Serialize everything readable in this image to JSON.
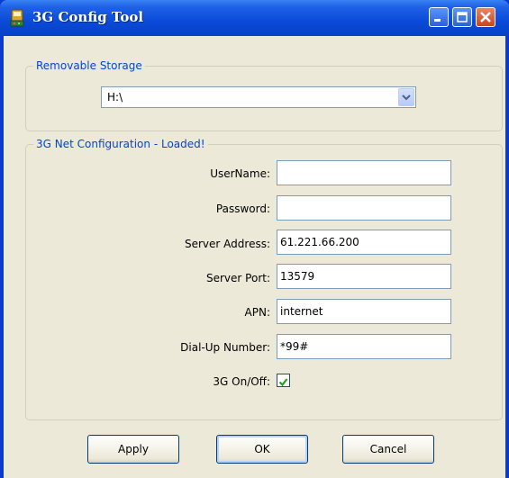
{
  "window": {
    "title": "3G Config Tool"
  },
  "removable_storage": {
    "legend": "Removable Storage",
    "selected_drive": "H:\\"
  },
  "net_config": {
    "legend": "3G Net Configuration - Loaded!",
    "fields": [
      {
        "label": "UserName:",
        "value": ""
      },
      {
        "label": "Password:",
        "value": ""
      },
      {
        "label": "Server Address:",
        "value": "61.221.66.200"
      },
      {
        "label": "Server Port:",
        "value": "13579"
      },
      {
        "label": "APN:",
        "value": "internet"
      },
      {
        "label": "Dial-Up Number:",
        "value": "*99#"
      }
    ],
    "toggle": {
      "label": "3G On/Off:",
      "checked": true
    }
  },
  "buttons": {
    "apply": "Apply",
    "ok": "OK",
    "cancel": "Cancel"
  },
  "colors": {
    "title_bar": "#0a4ad8",
    "group_legend": "#0046d5",
    "dialog_bg": "#ece9d8"
  }
}
